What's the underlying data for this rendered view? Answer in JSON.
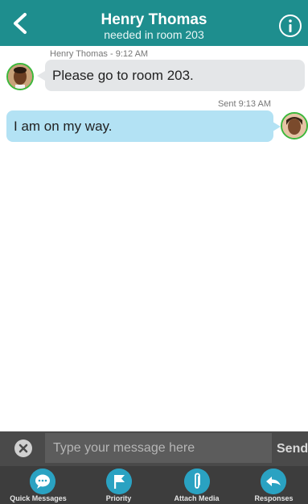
{
  "header": {
    "title": "Henry Thomas",
    "subtitle": "needed in room 203",
    "back_icon": "back-chevron-icon",
    "info_icon": "info-icon",
    "background_color": "#1e8e8e"
  },
  "messages": [
    {
      "direction": "incoming",
      "meta": "Henry Thomas - 9:12 AM",
      "text": "Please go to room 203.",
      "bubble_color": "#e4e6e8"
    },
    {
      "direction": "outgoing",
      "meta": "Sent  9:13 AM",
      "text": "I am on my way.",
      "bubble_color": "#b3e2f4"
    }
  ],
  "composer": {
    "placeholder": "Type your message here",
    "value": "",
    "send_label": "Send",
    "clear_icon": "clear-icon"
  },
  "toolbar": {
    "items": [
      {
        "label": "Quick Messages",
        "icon": "chat-bubble-icon"
      },
      {
        "label": "Priority",
        "icon": "flag-icon"
      },
      {
        "label": "Attach Media",
        "icon": "paperclip-icon"
      },
      {
        "label": "Responses",
        "icon": "reply-icon"
      }
    ],
    "accent_color": "#2aa2c2"
  }
}
